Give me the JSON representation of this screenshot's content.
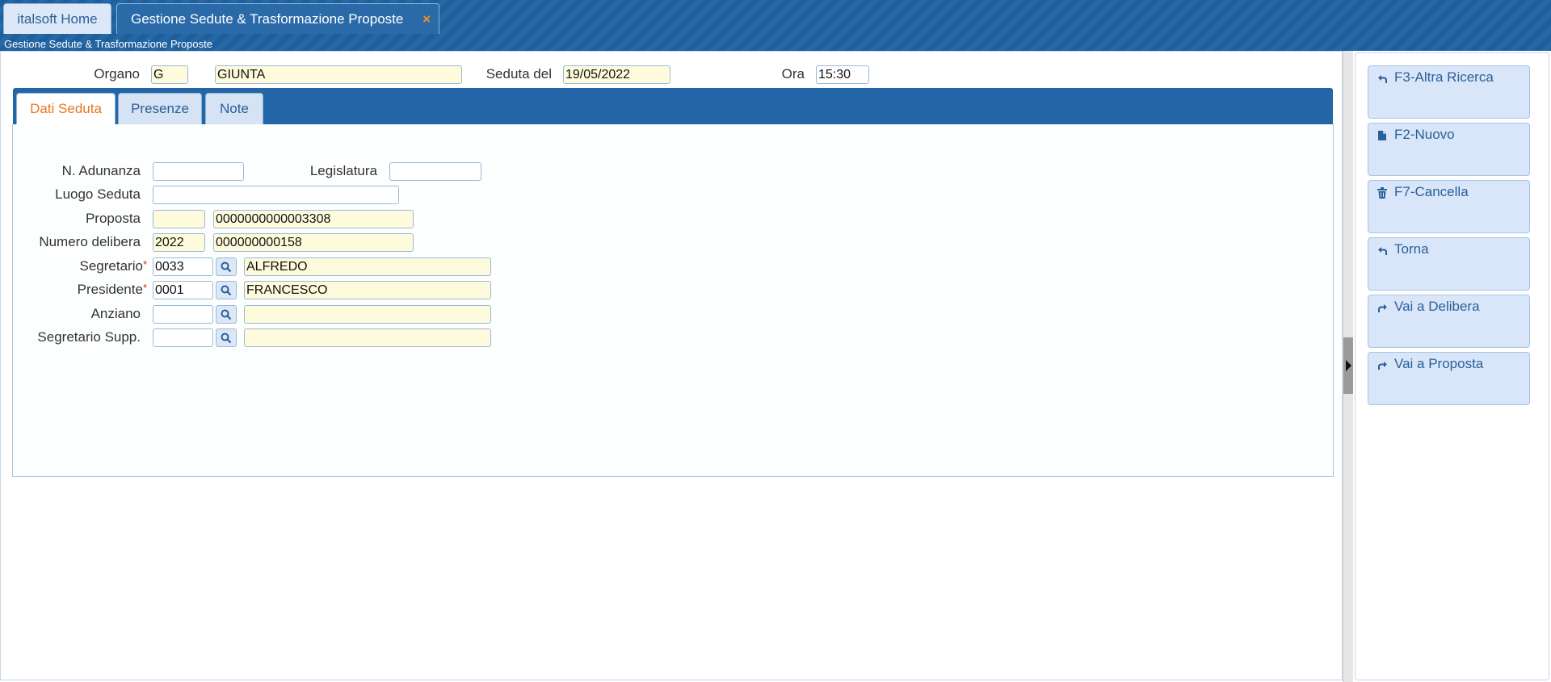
{
  "tabs": {
    "home_label": "italsoft Home",
    "active_label": "Gestione Sedute & Trasformazione Proposte",
    "close_glyph": "×"
  },
  "subtitle": "Gestione Sedute & Trasformazione Proposte",
  "header": {
    "organo_label": "Organo",
    "organo_code": "G",
    "organo_name": "GIUNTA",
    "seduta_label": "Seduta del",
    "seduta_date": "19/05/2022",
    "ora_label": "Ora",
    "ora_value": "15:30"
  },
  "inner_tabs": [
    "Dati Seduta",
    "Presenze",
    "Note"
  ],
  "form": {
    "adunanza_label": "N. Adunanza",
    "adunanza_value": "",
    "legislatura_label": "Legislatura",
    "legislatura_value": "",
    "luogo_label": "Luogo Seduta",
    "luogo_value": "",
    "proposta_label": "Proposta",
    "proposta_year": "",
    "proposta_number": "0000000000003308",
    "delibera_label": "Numero delibera",
    "delibera_year": "2022",
    "delibera_number": "000000000158",
    "segretario_label": "Segretario",
    "segretario_code": "0033",
    "segretario_name": "ALFREDO",
    "presidente_label": "Presidente",
    "presidente_code": "0001",
    "presidente_name": "FRANCESCO",
    "anziano_label": "Anziano",
    "anziano_code": "",
    "anziano_name": "",
    "segsupp_label": "Segretario Supp.",
    "segsupp_code": "",
    "segsupp_name": "",
    "required_mark": "*"
  },
  "side_buttons": [
    {
      "label": "F3-Altra Ricerca",
      "icon": "undo-icon"
    },
    {
      "label": "F2-Nuovo",
      "icon": "document-icon"
    },
    {
      "label": "F7-Cancella",
      "icon": "trash-icon"
    },
    {
      "label": "Torna",
      "icon": "undo-icon"
    },
    {
      "label": "Vai a Delibera",
      "icon": "redo-icon"
    },
    {
      "label": "Vai a Proposta",
      "icon": "redo-icon"
    }
  ],
  "colors": {
    "accent_blue": "#2266a8",
    "active_tab_text": "#e87722",
    "readonly_field": "#fefbdc",
    "button_bg": "#d9e6f9"
  }
}
